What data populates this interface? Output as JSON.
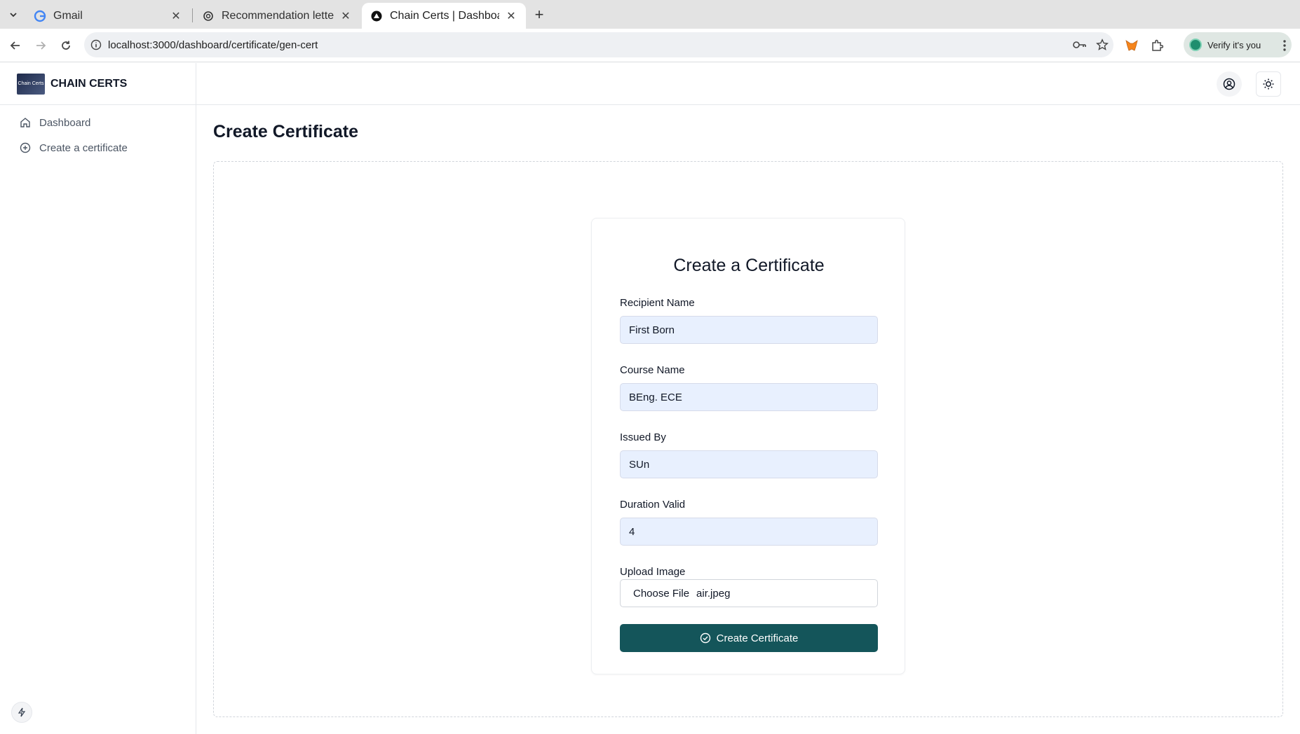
{
  "browser": {
    "tabs": [
      {
        "title": "Gmail",
        "icon": "google-icon"
      },
      {
        "title": "Recommendation letter",
        "icon": "openai-icon"
      },
      {
        "title": "Chain Certs | Dashboard",
        "icon": "vercel-icon",
        "active": true
      }
    ],
    "url": "localhost:3000/dashboard/certificate/gen-cert",
    "verify_label": "Verify it's you"
  },
  "app": {
    "brand": "CHAIN CERTS",
    "logo_text": "Chain Certs"
  },
  "sidebar": {
    "items": [
      {
        "label": "Dashboard",
        "icon": "home-icon"
      },
      {
        "label": "Create a certificate",
        "icon": "plus-circle-icon"
      }
    ]
  },
  "page": {
    "title": "Create Certificate"
  },
  "form": {
    "title": "Create a Certificate",
    "fields": [
      {
        "label": "Recipient Name",
        "value": "First Born"
      },
      {
        "label": "Course Name",
        "value": "BEng. ECE"
      },
      {
        "label": "Issued By",
        "value": "SUn"
      },
      {
        "label": "Duration Valid",
        "value": "4"
      }
    ],
    "upload": {
      "label": "Upload Image",
      "button": "Choose File",
      "filename": "air.jpeg"
    },
    "submit_label": "Create Certificate"
  },
  "colors": {
    "primary": "#14555a",
    "input_bg": "#e8f0fe"
  }
}
